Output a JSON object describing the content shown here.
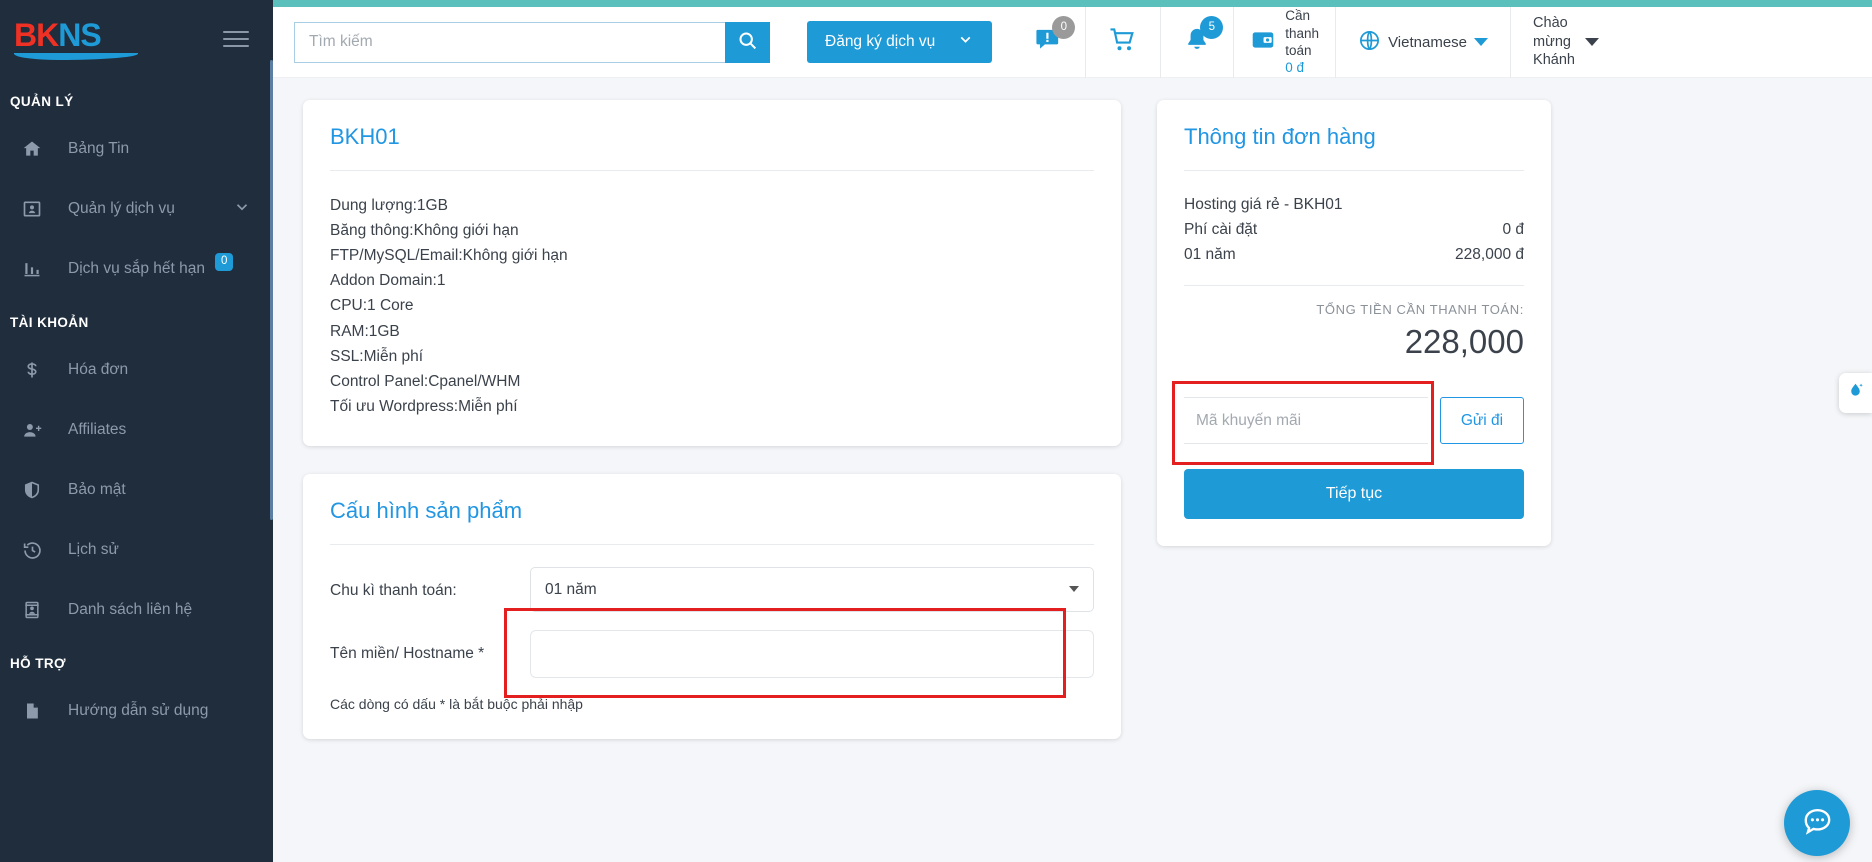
{
  "brand": {
    "name_bk": "BK",
    "name_ns": "NS",
    "accent": "#1e9ad6",
    "red": "#ee3124"
  },
  "sidebar": {
    "sections": [
      {
        "title": "QUẢN LÝ",
        "items": [
          {
            "label": "Bảng Tin",
            "icon": "home-icon",
            "badge": null,
            "caret": false
          },
          {
            "label": "Quản lý dịch vụ",
            "icon": "contact-card-icon",
            "badge": null,
            "caret": true
          },
          {
            "label": "Dịch vụ sắp hết hạn",
            "icon": "bar-chart-icon",
            "badge": "0",
            "caret": false
          }
        ]
      },
      {
        "title": "TÀI KHOẢN",
        "items": [
          {
            "label": "Hóa đơn",
            "icon": "dollar-icon",
            "badge": null,
            "caret": false
          },
          {
            "label": "Affiliates",
            "icon": "user-plus-icon",
            "badge": null,
            "caret": false
          },
          {
            "label": "Bảo mật",
            "icon": "shield-icon",
            "badge": null,
            "caret": false
          },
          {
            "label": "Lịch sử",
            "icon": "history-icon",
            "badge": null,
            "caret": false
          },
          {
            "label": "Danh sách liên hệ",
            "icon": "contacts-icon",
            "badge": null,
            "caret": false
          }
        ]
      },
      {
        "title": "HỖ TRỢ",
        "items": [
          {
            "label": "Hướng dẫn sử dụng",
            "icon": "document-icon",
            "badge": null,
            "caret": false
          }
        ]
      }
    ]
  },
  "header": {
    "search_placeholder": "Tìm kiếm",
    "search_value": "",
    "search_icon": "search-icon",
    "register_button": "Đăng ký dịch vụ",
    "alert_icon": "alert-message-icon",
    "alert_badge": "0",
    "cart_icon": "cart-icon",
    "bell_icon": "bell-icon",
    "bell_badge": "5",
    "wallet_icon": "wallet-icon",
    "wallet_label_line1": "Cần",
    "wallet_label_line2": "thanh",
    "wallet_label_line3": "toán",
    "wallet_amount": "0 đ",
    "language_icon": "globe-icon",
    "language": "Vietnamese",
    "greeting_line1": "Chào",
    "greeting_line2": "mừng",
    "greeting_line3": "Khánh"
  },
  "product": {
    "title": "BKH01",
    "specs": [
      "Dung lượng:1GB",
      "Băng thông:Không giới hạn",
      "FTP/MySQL/Email:Không giới hạn",
      "Addon Domain:1",
      "CPU:1 Core",
      "RAM:1GB",
      "SSL:Miễn phí",
      "Control Panel:Cpanel/WHM",
      "Tối ưu Wordpress:Miễn phí"
    ]
  },
  "config": {
    "title": "Cấu hình sản phẩm",
    "billing_cycle_label": "Chu kì thanh toán:",
    "billing_cycle_value": "01 năm",
    "billing_cycle_options": [
      "01 năm"
    ],
    "hostname_label": "Tên miền/ Hostname *",
    "hostname_value": "",
    "hostname_placeholder": "",
    "required_note": "Các dòng có dấu * là bắt buộc phải nhập"
  },
  "order": {
    "title": "Thông tin đơn hàng",
    "lines": [
      {
        "label": "Hosting giá rẻ - BKH01",
        "value": ""
      },
      {
        "label": "Phí cài đặt",
        "value": "0 đ"
      },
      {
        "label": "01 năm",
        "value": "228,000 đ"
      }
    ],
    "total_label": "TỔNG TIỀN CẦN THANH TOÁN:",
    "total_amount": "228,000",
    "promo_placeholder": "Mã khuyến mãi",
    "promo_value": "",
    "send_button": "Gửi đi",
    "continue_button": "Tiếp tục"
  },
  "widgets": {
    "drop_icon": "water-drop-icon",
    "chat_icon": "chat-bubble-icon"
  }
}
